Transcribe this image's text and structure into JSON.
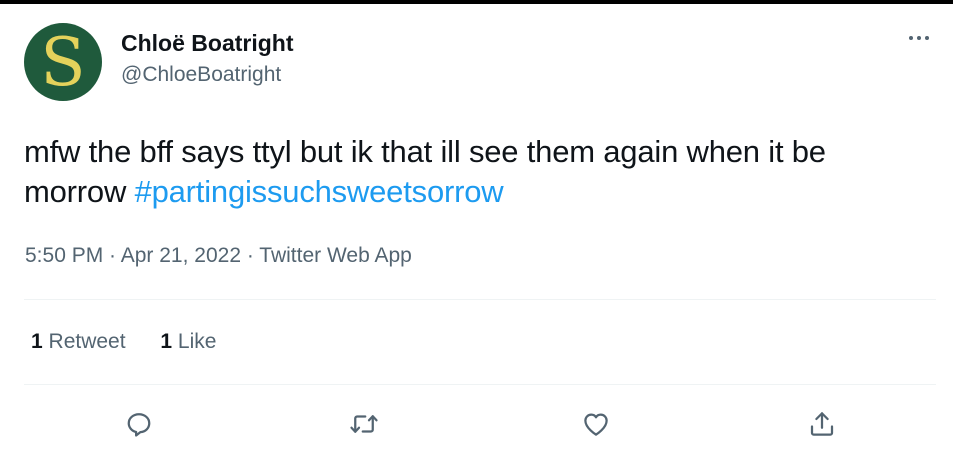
{
  "author": {
    "display_name": "Chloë Boatright",
    "handle": "@ChloeBoatright",
    "avatar_letter": "S",
    "avatar_bg": "#1f5a3c",
    "avatar_fg": "#e4d25b"
  },
  "tweet": {
    "text": "mfw the bff says ttyl but ik that ill see them again when it be morrow ",
    "hashtag": "#partingissuchsweetsorrow"
  },
  "meta": {
    "time": "5:50 PM",
    "separator": " · ",
    "date": "Apr 21, 2022",
    "app": "Twitter Web App"
  },
  "stats": {
    "retweets_count": "1",
    "retweets_label": " Retweet",
    "likes_count": "1",
    "likes_label": " Like"
  },
  "actions": {
    "reply_icon": "reply-icon",
    "retweet_icon": "retweet-icon",
    "like_icon": "heart-icon",
    "share_icon": "share-icon"
  },
  "colors": {
    "text": "#0f1419",
    "secondary": "#536471",
    "link": "#1d9bf0",
    "divider": "#eff3f4"
  }
}
